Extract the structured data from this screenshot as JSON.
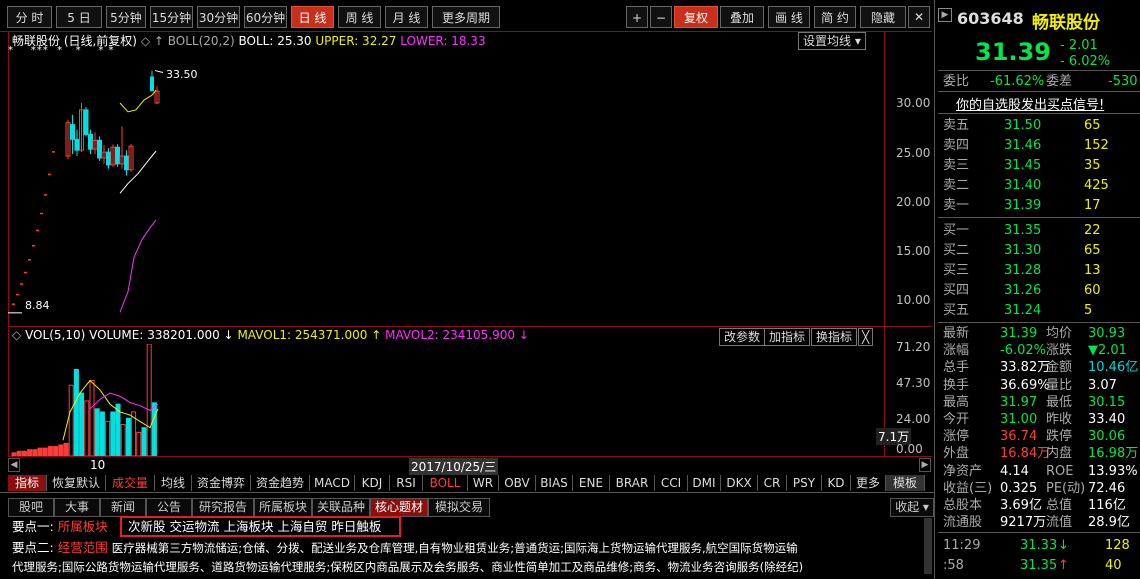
{
  "toolbar": {
    "periods": [
      "分 时",
      "5 日",
      "5分钟",
      "15分钟",
      "30分钟",
      "60分钟",
      "日 线",
      "周 线",
      "月 线",
      "更多周期"
    ],
    "tools": [
      "+",
      "−",
      "复权",
      "叠加",
      "画 线",
      "简 约",
      "隐藏"
    ]
  },
  "quote": {
    "code": "603648",
    "name": "畅联股份",
    "price": "31.39",
    "change": "- 2.01",
    "change_pct": "- 6.02%",
    "webi_label": "委比",
    "webi": "-61.62%",
    "weicha_label": "委差",
    "weicha": "-530",
    "signal": "你的自选股发出买点信号!",
    "asks": [
      {
        "label": "卖五",
        "price": "31.50",
        "vol": "65"
      },
      {
        "label": "卖四",
        "price": "31.46",
        "vol": "152"
      },
      {
        "label": "卖三",
        "price": "31.45",
        "vol": "35"
      },
      {
        "label": "卖二",
        "price": "31.40",
        "vol": "425"
      },
      {
        "label": "卖一",
        "price": "31.39",
        "vol": "17"
      }
    ],
    "bids": [
      {
        "label": "买一",
        "price": "31.35",
        "vol": "22"
      },
      {
        "label": "买二",
        "price": "31.30",
        "vol": "65"
      },
      {
        "label": "买三",
        "price": "31.28",
        "vol": "13"
      },
      {
        "label": "买四",
        "price": "31.26",
        "vol": "60"
      },
      {
        "label": "买五",
        "price": "31.24",
        "vol": "5"
      }
    ],
    "stats": [
      {
        "l1": "最新",
        "v1": "31.39",
        "c1": "green",
        "l2": "均价",
        "v2": "30.93",
        "c2": "green"
      },
      {
        "l1": "涨幅",
        "v1": "-6.02%",
        "c1": "green",
        "l2": "涨跌",
        "v2": "▼2.01",
        "c2": "green"
      },
      {
        "l1": "总手",
        "v1": "33.82万",
        "c1": "white",
        "l2": "金额",
        "v2": "10.46亿",
        "c2": "cyan"
      },
      {
        "l1": "换手",
        "v1": "36.69%",
        "c1": "white",
        "l2": "量比",
        "v2": "3.07",
        "c2": "white"
      },
      {
        "l1": "最高",
        "v1": "31.97",
        "c1": "green",
        "l2": "最低",
        "v2": "30.15",
        "c2": "green"
      },
      {
        "l1": "今开",
        "v1": "31.00",
        "c1": "green",
        "l2": "昨收",
        "v2": "33.40",
        "c2": "white"
      },
      {
        "l1": "涨停",
        "v1": "36.74",
        "c1": "red",
        "l2": "跌停",
        "v2": "30.06",
        "c2": "green"
      },
      {
        "l1": "外盘",
        "v1": "16.84万",
        "c1": "red",
        "l2": "内盘",
        "v2": "16.98万",
        "c2": "green"
      },
      {
        "l1": "净资产",
        "v1": "4.14",
        "c1": "white",
        "l2": "ROE",
        "v2": "13.93%",
        "c2": "white"
      },
      {
        "l1": "收益(三)",
        "v1": "0.325",
        "c1": "white",
        "l2": "PE(动)",
        "v2": "72.46",
        "c2": "white"
      },
      {
        "l1": "总股本",
        "v1": "3.69亿",
        "c1": "white",
        "l2": "总值",
        "v2": "116亿",
        "c2": "white"
      },
      {
        "l1": "流通股",
        "v1": "9217万",
        "c1": "white",
        "l2": "流值",
        "v2": "28.9亿",
        "c2": "white"
      }
    ],
    "ticks": [
      {
        "time": "11:29",
        "price": "31.33",
        "arrow": "↓",
        "vol": "128"
      },
      {
        "time": ":58",
        "price": "31.35",
        "arrow": "↑",
        "vol": "40"
      }
    ]
  },
  "kline": {
    "title": "畅联股份 (日线,前复权)",
    "indicator_prefix": "◇ ↑ BOLL(20,2)",
    "boll": "BOLL: 25.30",
    "upper": "UPPER: 32.27",
    "lower": "LOWER: 18.33",
    "settings_btn": "设置均线 ▾",
    "high_label": "33.50",
    "low_label": "8.84",
    "star_marks": "*    ***  *   *    * *",
    "yticks": [
      "30.00",
      "25.00",
      "20.00",
      "15.00",
      "10.00"
    ]
  },
  "volume": {
    "title": "VOL(5,10)",
    "volume": "VOLUME: 338201.000 ↓",
    "mavol1": "MAVOL1: 254371.000 ↑",
    "mavol2": "MAVOL2: 234105.900 ↓",
    "btns": [
      "改参数",
      "加指标",
      "换指标",
      "╳"
    ],
    "yticks": [
      "71.20",
      "47.30",
      "24.00"
    ],
    "unit": "7.1万",
    "zero": "0.00"
  },
  "xaxis": {
    "day_label": "10",
    "date_label": "2017/10/25/三"
  },
  "indicator_tabs": [
    "指标",
    "恢复默认",
    "成交量",
    "均线",
    "资金博弈",
    "资金趋势",
    "MACD",
    "KDJ",
    "RSI",
    "BOLL",
    "WR",
    "OBV",
    "BIAS",
    "ENE",
    "BRAR",
    "CCI",
    "DMI",
    "DKX",
    "CR",
    "PSY",
    "KD",
    "更多",
    "模板"
  ],
  "f10_tabs": [
    "股吧",
    "大事",
    "新闻",
    "公告",
    "研究报告",
    "所属板块",
    "关联品种",
    "核心题材",
    "模拟交易"
  ],
  "collapse_btn": "收起 ▾",
  "points": [
    {
      "label": "要点一:",
      "key": "所属板块",
      "text": "次新股 交运物流 上海板块 上海自贸 昨日触板"
    },
    {
      "label": "要点二:",
      "key": "经营范围",
      "text": "医疗器械第三方物流储运;仓储、分拨、配送业务及仓库管理,自有物业租赁业务;普通货运;国际海上货物运输代理服务,航空国际货物运输"
    },
    {
      "label": "",
      "key": "",
      "text": "代理服务;国际公路货物运输代理服务、道路货物运输代理服务;保税区内商品展示及会务服务、商业性简单加工及商品维修;商务、物流业务咨询服务(除经纪)"
    }
  ],
  "chart_data": {
    "type": "candlestick",
    "y_unit": "price",
    "ylim": [
      7.5,
      36
    ],
    "last_price": 31.39,
    "high": 33.5,
    "low": 8.84,
    "vol_ylim": [
      0,
      71.2
    ]
  }
}
